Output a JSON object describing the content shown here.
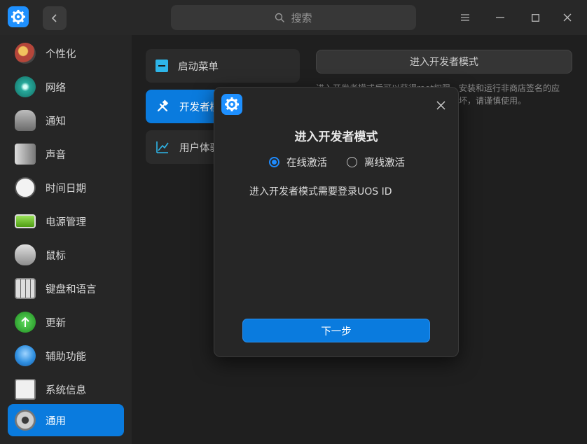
{
  "search": {
    "placeholder": "搜索"
  },
  "sidebar": {
    "items": [
      {
        "label": "个性化",
        "icon": "personalization-icon",
        "color": "#b5463a"
      },
      {
        "label": "网络",
        "icon": "network-icon",
        "color": "#27a89a"
      },
      {
        "label": "通知",
        "icon": "notification-icon",
        "color": "#8a8a8a"
      },
      {
        "label": "声音",
        "icon": "sound-icon",
        "color": "#9a9a9a"
      },
      {
        "label": "时间日期",
        "icon": "clock-icon",
        "color": "#e9e9e9"
      },
      {
        "label": "电源管理",
        "icon": "power-icon",
        "color": "#6cc51d"
      },
      {
        "label": "鼠标",
        "icon": "mouse-icon",
        "color": "#bdbdbd"
      },
      {
        "label": "键盘和语言",
        "icon": "keyboard-icon",
        "color": "#aaaaaa"
      },
      {
        "label": "更新",
        "icon": "update-icon",
        "color": "#3fbf3f"
      },
      {
        "label": "辅助功能",
        "icon": "accessibility-icon",
        "color": "#2f8fe0"
      },
      {
        "label": "系统信息",
        "icon": "system-info-icon",
        "color": "#cfcfcf"
      },
      {
        "label": "通用",
        "icon": "general-gear-icon",
        "color": "#9f9f9f"
      }
    ]
  },
  "middle": {
    "items": [
      {
        "label": "启动菜单",
        "icon": "boot-menu-icon"
      },
      {
        "label": "开发者模式",
        "icon": "developer-tools-icon"
      },
      {
        "label": "用户体验计划",
        "icon": "user-experience-icon"
      }
    ]
  },
  "content": {
    "dev_button": "进入开发者模式",
    "description": "进入开发者模式后可以获得root权限，安装和运行非商店签名的应用，但同时可能导致系统完整性遭到破坏，请谨慎使用。"
  },
  "dialog": {
    "title": "进入开发者模式",
    "option_online": "在线激活",
    "option_offline": "离线激活",
    "message": "进入开发者模式需要登录UOS ID",
    "next_button": "下一步"
  },
  "colors": {
    "accent": "#0a7bde",
    "background": "#1f1f1f"
  }
}
